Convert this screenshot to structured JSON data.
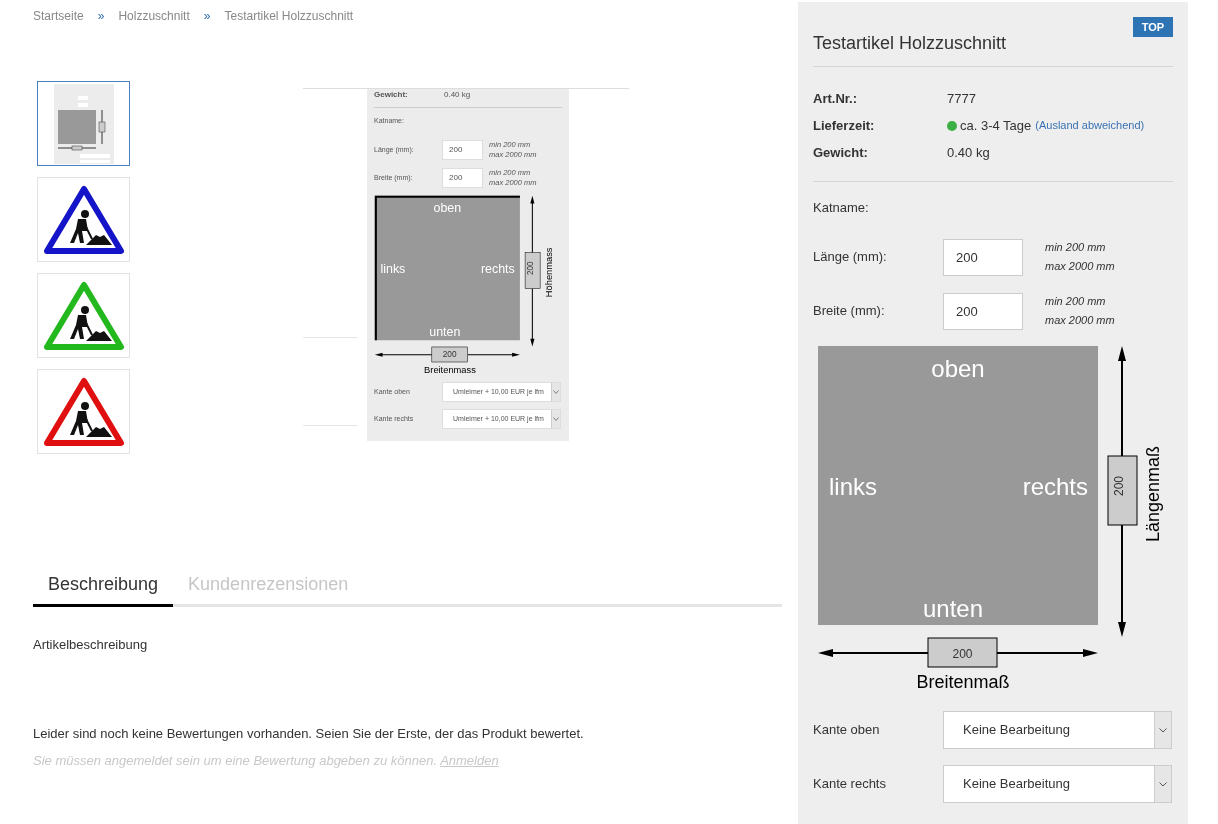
{
  "breadcrumb": [
    {
      "kind": "link",
      "text": "Startseite"
    },
    {
      "kind": "separator",
      "text": "»"
    },
    {
      "kind": "link",
      "text": "Holzzuschnitt"
    },
    {
      "kind": "separator",
      "text": "»"
    },
    {
      "kind": "current",
      "text": "Testartikel Holzzuschnitt"
    }
  ],
  "thumbnails": [
    {
      "kind": "screenshot",
      "selected": true
    },
    {
      "kind": "sign",
      "color": "#1414c8",
      "selected": false
    },
    {
      "kind": "sign",
      "color": "#22b81e",
      "selected": false
    },
    {
      "kind": "sign",
      "color": "#e01010",
      "selected": false
    }
  ],
  "main_image": {
    "weight_label": "Gewicht:",
    "weight_value": "0.40 kg",
    "katname": "Katname:",
    "fields": [
      {
        "label": "Länge (mm):",
        "value": "200",
        "min": "min 200 mm",
        "max": "max 2000 mm"
      },
      {
        "label": "Breite (mm):",
        "value": "200",
        "min": "min 200 mm",
        "max": "max 2000 mm"
      }
    ],
    "diagram": {
      "top": "oben",
      "left": "links",
      "right": "rechts",
      "bottom": "unten",
      "height_value": "200",
      "height_label": "Höhenmass",
      "width_value": "200",
      "width_label": "Breitenmass"
    },
    "selects": [
      {
        "label": "Kante oben",
        "value": "Umleimer + 10,00 EUR je lfm"
      },
      {
        "label": "Kante rechts",
        "value": "Umleimer + 10,00 EUR je lfm"
      }
    ]
  },
  "tabs": [
    {
      "label": "Beschreibung",
      "selected": true
    },
    {
      "label": "Kundenrezensionen",
      "selected": false
    }
  ],
  "description": "Artikelbeschreibung",
  "reviews_note": "Leider sind noch keine Bewertungen vorhanden. Seien Sie der Erste, der das Produkt bewertet.",
  "login_note": {
    "text": "Sie müssen angemeldet sein um eine Bewertung abgeben zu können.",
    "link": "Anmelden"
  },
  "product": {
    "badge": "TOP",
    "title": "Testartikel Holzzuschnitt",
    "specs": [
      {
        "label": "Art.Nr.:",
        "value": "7777"
      },
      {
        "label": "Lieferzeit:",
        "value": "ca. 3-4 Tage",
        "color": "#3cb043",
        "note": "(Ausland abweichend)"
      },
      {
        "label": "Gewicht:",
        "value": "0.40 kg"
      }
    ],
    "katname": "Katname:",
    "fields": [
      {
        "label": "Länge (mm):",
        "value": "200",
        "min": "min 200 mm",
        "max": "max 2000 mm"
      },
      {
        "label": "Breite (mm):",
        "value": "200",
        "min": "min 200 mm",
        "max": "max 2000 mm"
      }
    ],
    "diagram": {
      "top": "oben",
      "left": "links",
      "right": "rechts",
      "bottom": "unten",
      "height_value": "200",
      "height_label": "Längenmaß",
      "width_value": "200",
      "width_label": "Breitenmaß"
    },
    "selects": [
      {
        "label": "Kante oben",
        "value": "Keine Bearbeitung"
      },
      {
        "label": "Kante rechts",
        "value": "Keine Bearbeitung"
      }
    ]
  }
}
